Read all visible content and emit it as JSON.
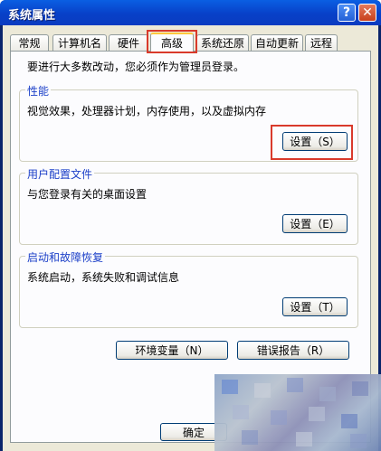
{
  "window": {
    "title": "系统属性"
  },
  "titlebar": {
    "help": "?",
    "close": "✕"
  },
  "tabs": [
    {
      "label": "常规"
    },
    {
      "label": "计算机名"
    },
    {
      "label": "硬件"
    },
    {
      "label": "高级"
    },
    {
      "label": "系统还原"
    },
    {
      "label": "自动更新"
    },
    {
      "label": "远程"
    }
  ],
  "intro": "要进行大多数改动，您必须作为管理员登录。",
  "groups": {
    "performance": {
      "title": "性能",
      "desc": "视觉效果，处理器计划，内存使用，以及虚拟内存",
      "button": "设置（S）"
    },
    "profile": {
      "title": "用户配置文件",
      "desc": "与您登录有关的桌面设置",
      "button": "设置（E）"
    },
    "startup": {
      "title": "启动和故障恢复",
      "desc": "系统启动，系统失败和调试信息",
      "button": "设置（T）"
    }
  },
  "buttons": {
    "env": "环境变量（N）",
    "error": "错误报告（R）",
    "ok": "确定"
  },
  "colors": {
    "highlight": "#d93a2b",
    "title_bar": "#0a5fe3",
    "group_title": "#1b3fc8"
  }
}
